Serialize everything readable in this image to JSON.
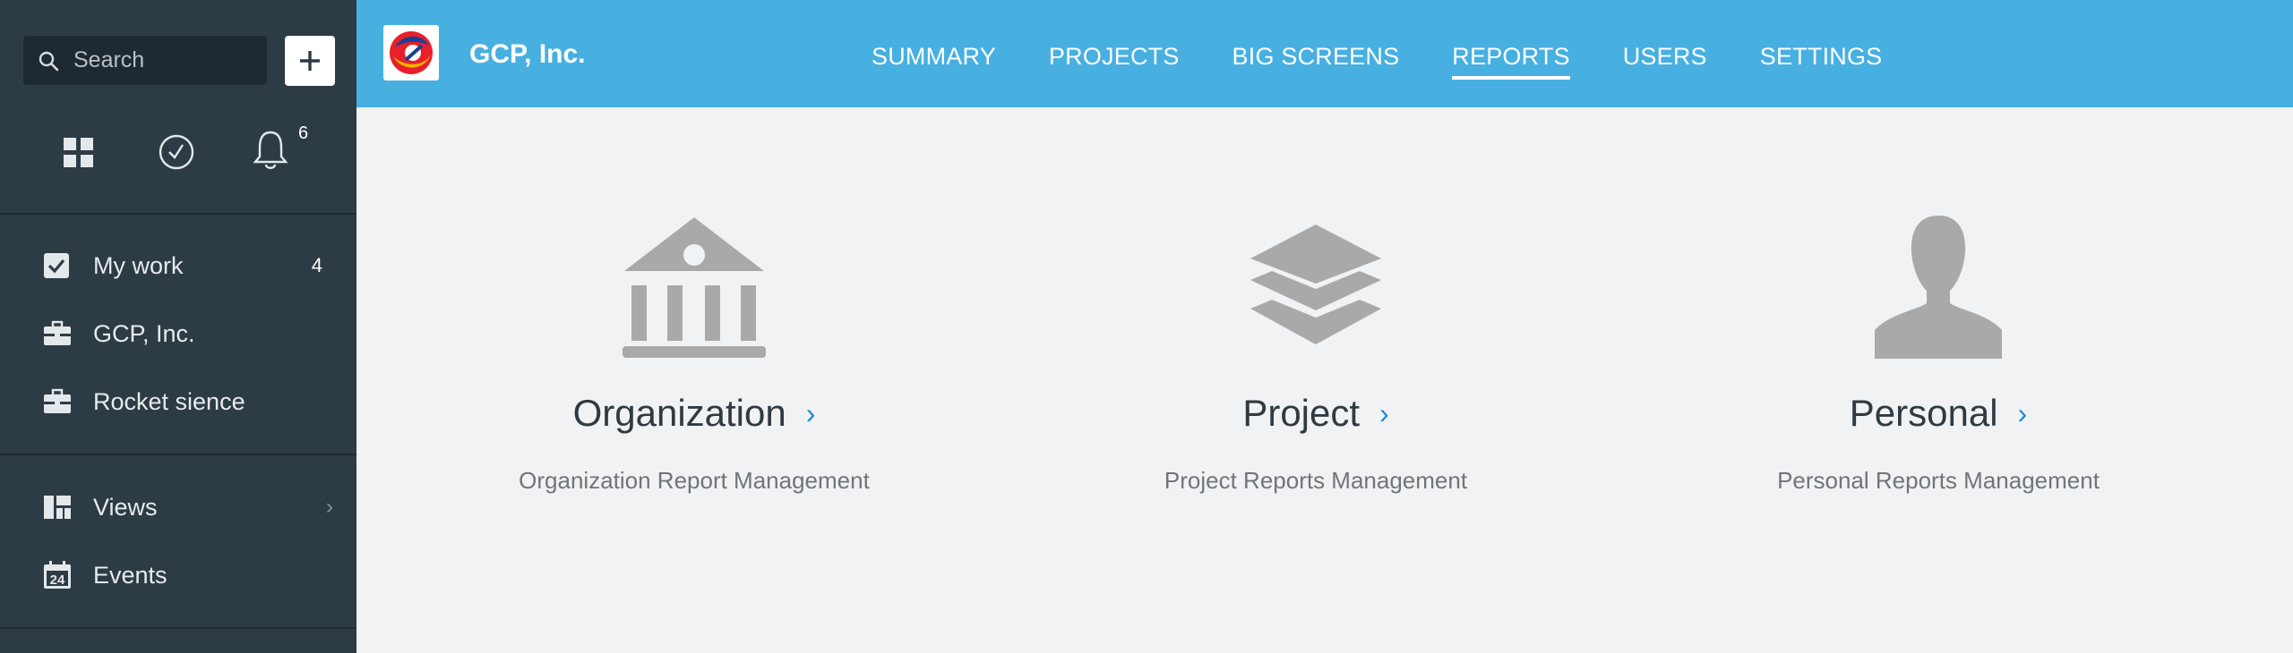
{
  "sidebar": {
    "search_placeholder": "Search",
    "notifications_count": "6",
    "items": [
      {
        "label": "My work",
        "count": "4",
        "icon": "checkbox-icon"
      },
      {
        "label": "GCP, Inc.",
        "icon": "briefcase-icon"
      },
      {
        "label": "Rocket sience",
        "icon": "briefcase-icon"
      },
      {
        "label": "Views",
        "icon": "layout-icon"
      },
      {
        "label": "Events",
        "icon": "calendar-icon",
        "calendar_day": "24"
      }
    ]
  },
  "header": {
    "company_name": "GCP, Inc.",
    "nav": [
      "SUMMARY",
      "PROJECTS",
      "BIG SCREENS",
      "REPORTS",
      "USERS",
      "SETTINGS"
    ],
    "active_nav": "REPORTS"
  },
  "reports": [
    {
      "title": "Organization",
      "description": "Organization Report Management",
      "icon": "bank-icon"
    },
    {
      "title": "Project",
      "description": "Project Reports Management",
      "icon": "layers-icon"
    },
    {
      "title": "Personal",
      "description": "Personal Reports Management",
      "icon": "person-icon"
    }
  ],
  "colors": {
    "sidebar_bg": "#2d3b45",
    "topbar_bg": "#47b0e1",
    "content_bg": "#f1f2f4",
    "icon_gray": "#a9a9a9",
    "link_blue": "#1a8ad0"
  }
}
